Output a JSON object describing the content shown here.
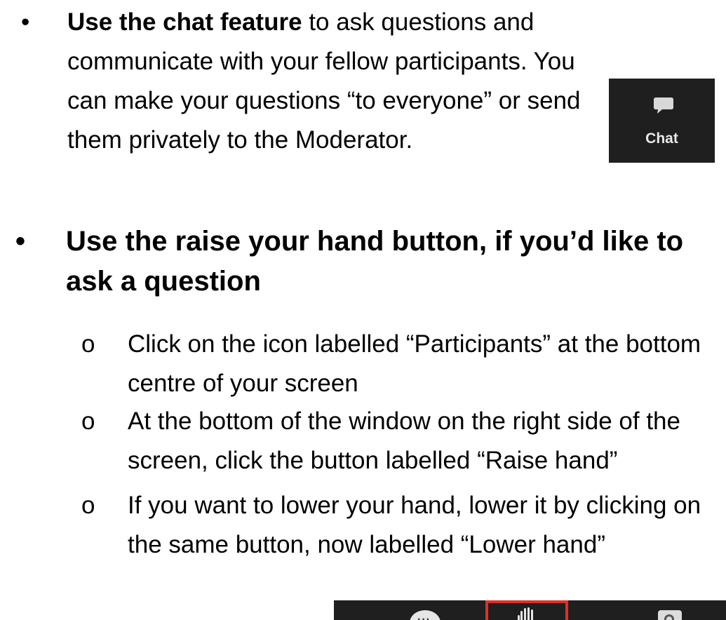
{
  "bullet_chat": {
    "marker": "•",
    "bold_text": "Use the chat feature",
    "rest_text": " to ask questions and communicate with your fellow participants. You can make your questions “to everyone” or send them privately to the Moderator.",
    "chat_icon_label": "Chat",
    "chat_icon": "speech-bubble-icon"
  },
  "bullet_raise": {
    "marker": "•",
    "title": "Use the raise your hand button, if you’d like to ask a question",
    "sub_marker": "o",
    "steps": [
      "Click on the icon labelled “Participants” at the bottom centre of your screen",
      "At the bottom of the window on the right side of the screen, click the button labelled “Raise hand”",
      "If you want to lower your hand, lower it by clicking on the same button, now labelled “Lower hand”"
    ]
  },
  "toolbar": {
    "icons": [
      "chat-bubble-icon",
      "raise-hand-icon",
      "record-icon"
    ],
    "highlight_color": "#e0302a",
    "background_color": "#1f1f1f"
  }
}
